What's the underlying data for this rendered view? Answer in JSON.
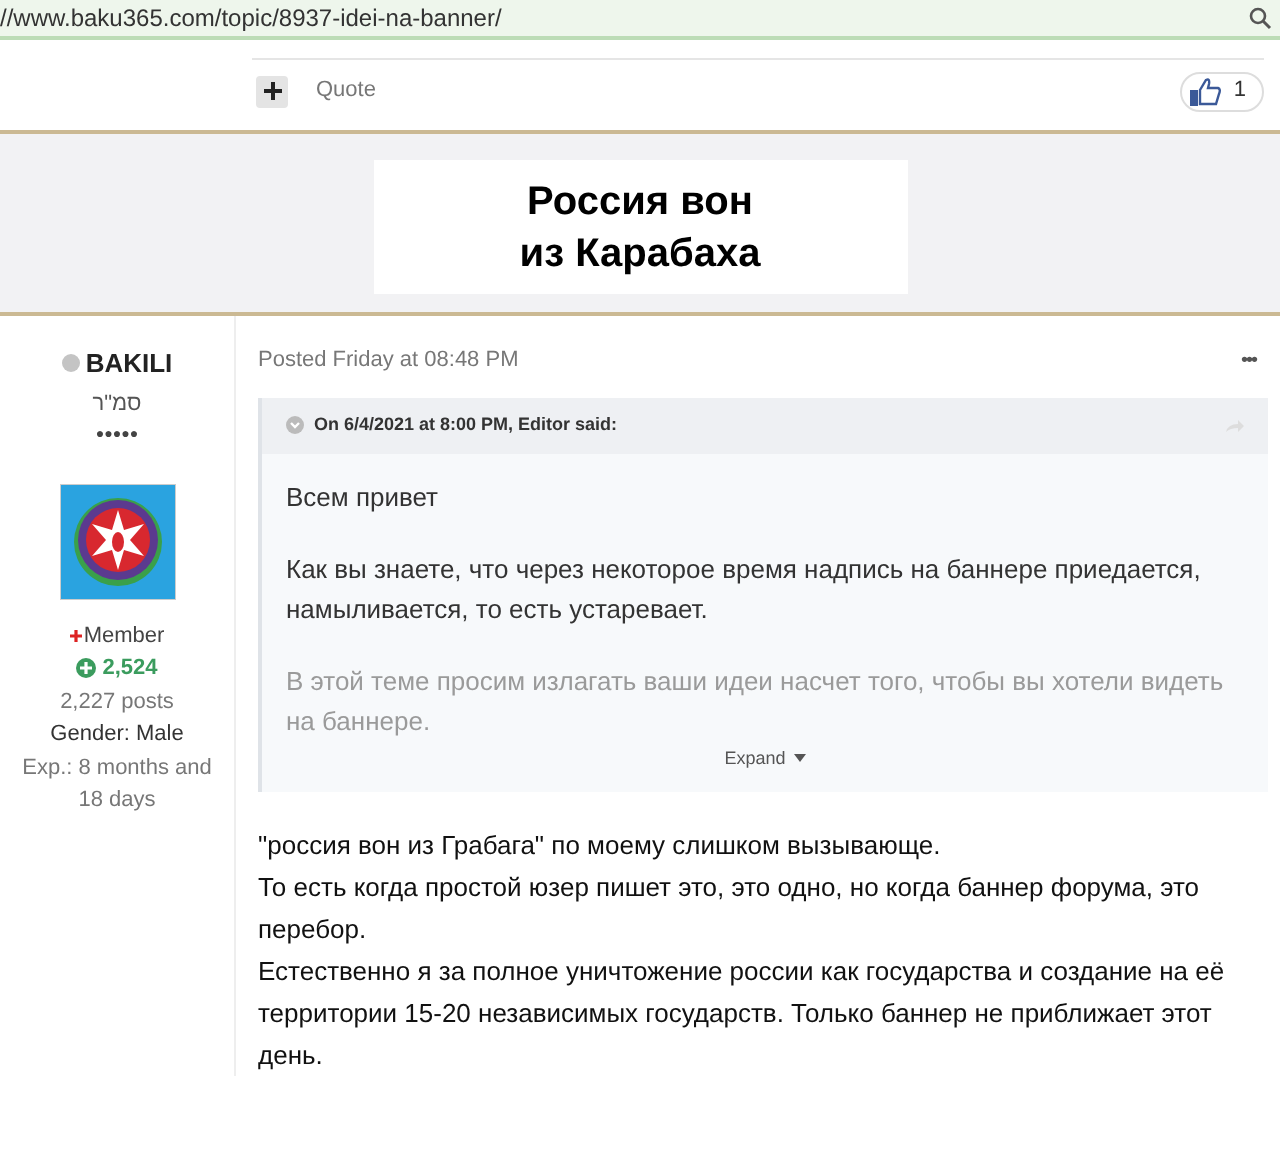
{
  "address_bar": {
    "url": "//www.baku365.com/topic/8937-idei-na-banner/"
  },
  "prev_post": {
    "quote_label": "Quote",
    "reaction_count": "1"
  },
  "banner": {
    "lines": [
      "Россия вон",
      "из Карабаха"
    ]
  },
  "author": {
    "name": "BAKILI",
    "online": false,
    "rank_title": "סמ\"ר",
    "rank_pips": "●●●●●",
    "group": "Member",
    "reputation": "2,524",
    "posts": "2,227 posts",
    "gender": "Gender: Male",
    "experience": "Exp.: 8 months and 18 days"
  },
  "post": {
    "posted": "Posted Friday at 08:48 PM",
    "menu": "•••",
    "quote": {
      "citation": "On 6/4/2021 at 8:00 PM, Editor said:",
      "paragraphs": [
        "Всем привет",
        "Как вы знаете, что через некоторое время надпись на баннере приедается, намыливается, то есть устаревает.",
        "В этой теме просим излагать ваши идеи насчет того, чтобы вы хотели видеть на баннере."
      ],
      "expand": "Expand"
    },
    "lines": [
      "\"россия вон из Грабага\" по моему слишком вызывающе.",
      "То есть когда простой юзер пишет это, это одно, но когда баннер форума, это перебор.",
      "Естественно я за полное уничтожение россии как государства и создание на её территории 15-20 независимых государств. Только баннер не приближает этот день."
    ]
  }
}
